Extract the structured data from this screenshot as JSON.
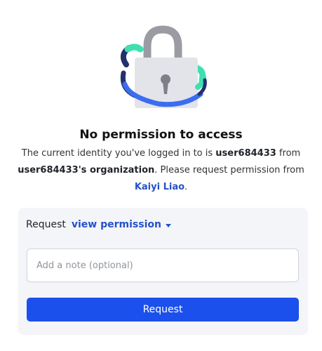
{
  "illustration": {
    "icon": "padlock-icon",
    "colors": {
      "shackle": "#9b9ca3",
      "body": "#e3e4e9",
      "keyhole": "#7d8088",
      "ring_teal": "#3fe0b0",
      "ring_blue": "#3a6df0",
      "ring_navy": "#23306e"
    }
  },
  "heading": "No permission to access",
  "description": {
    "part1": "The current identity you've logged in to is ",
    "user": "user684433",
    "part2": " from ",
    "organization": "user684433's organization",
    "part3": ". Please request permission from ",
    "owner": "Kaiyi Liao",
    "part4": "."
  },
  "request": {
    "label": "Request",
    "permission": "view permission",
    "permission_icon": "caret-down-icon",
    "note_placeholder": "Add a note (optional)",
    "note_value": "",
    "button_label": "Request"
  },
  "colors": {
    "accent": "#1c50ec",
    "link": "#2451c7",
    "panel_bg": "#f4f5f9"
  }
}
